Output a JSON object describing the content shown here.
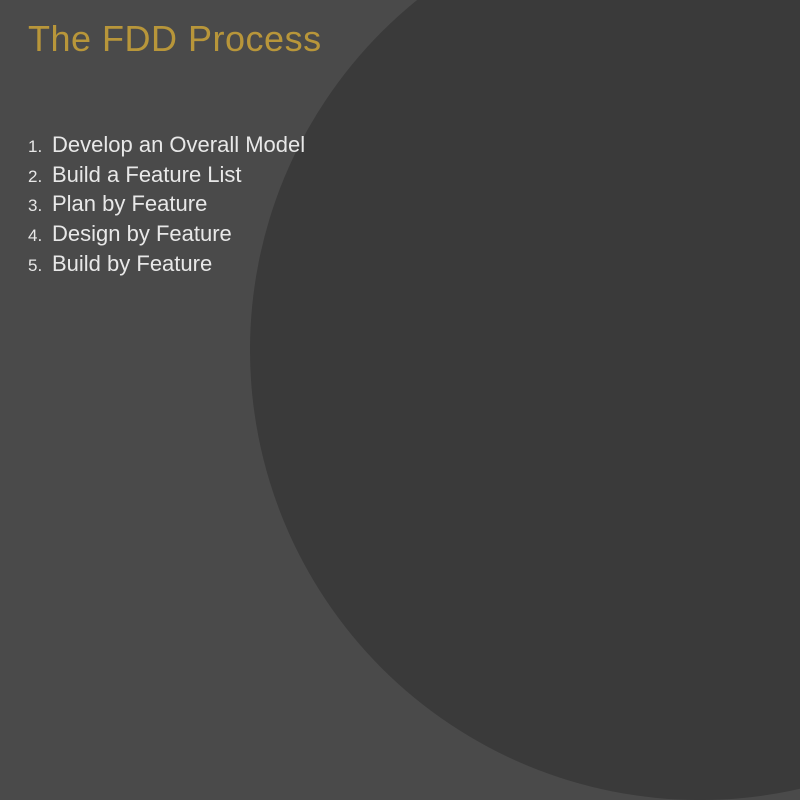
{
  "slide": {
    "title": "The FDD Process",
    "items": [
      {
        "number": "1.",
        "text": "Develop an Overall Model"
      },
      {
        "number": "2.",
        "text": "Build a Feature List"
      },
      {
        "number": "3.",
        "text": "Plan by Feature"
      },
      {
        "number": "4.",
        "text": "Design by Feature"
      },
      {
        "number": "5.",
        "text": "Build by Feature"
      }
    ]
  }
}
